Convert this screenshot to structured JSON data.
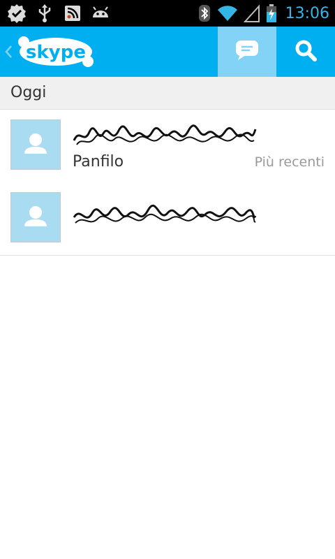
{
  "status_bar": {
    "time": "13:06",
    "left_icons": [
      "check-badge-icon",
      "usb-icon",
      "rss-icon",
      "android-icon"
    ],
    "right_icons": [
      "bluetooth-icon",
      "wifi-icon",
      "signal-icon",
      "battery-charging-icon"
    ]
  },
  "app_bar": {
    "logo_text": "skype",
    "actions": [
      "chat-icon",
      "search-icon"
    ],
    "accent_color": "#00aff0",
    "active_action_color": "#83d3f6"
  },
  "section": {
    "header": "Oggi"
  },
  "conversations": [
    {
      "mood_message": "Panfilo",
      "meta": "Più recenti"
    },
    {
      "mood_message": "",
      "meta": ""
    }
  ]
}
